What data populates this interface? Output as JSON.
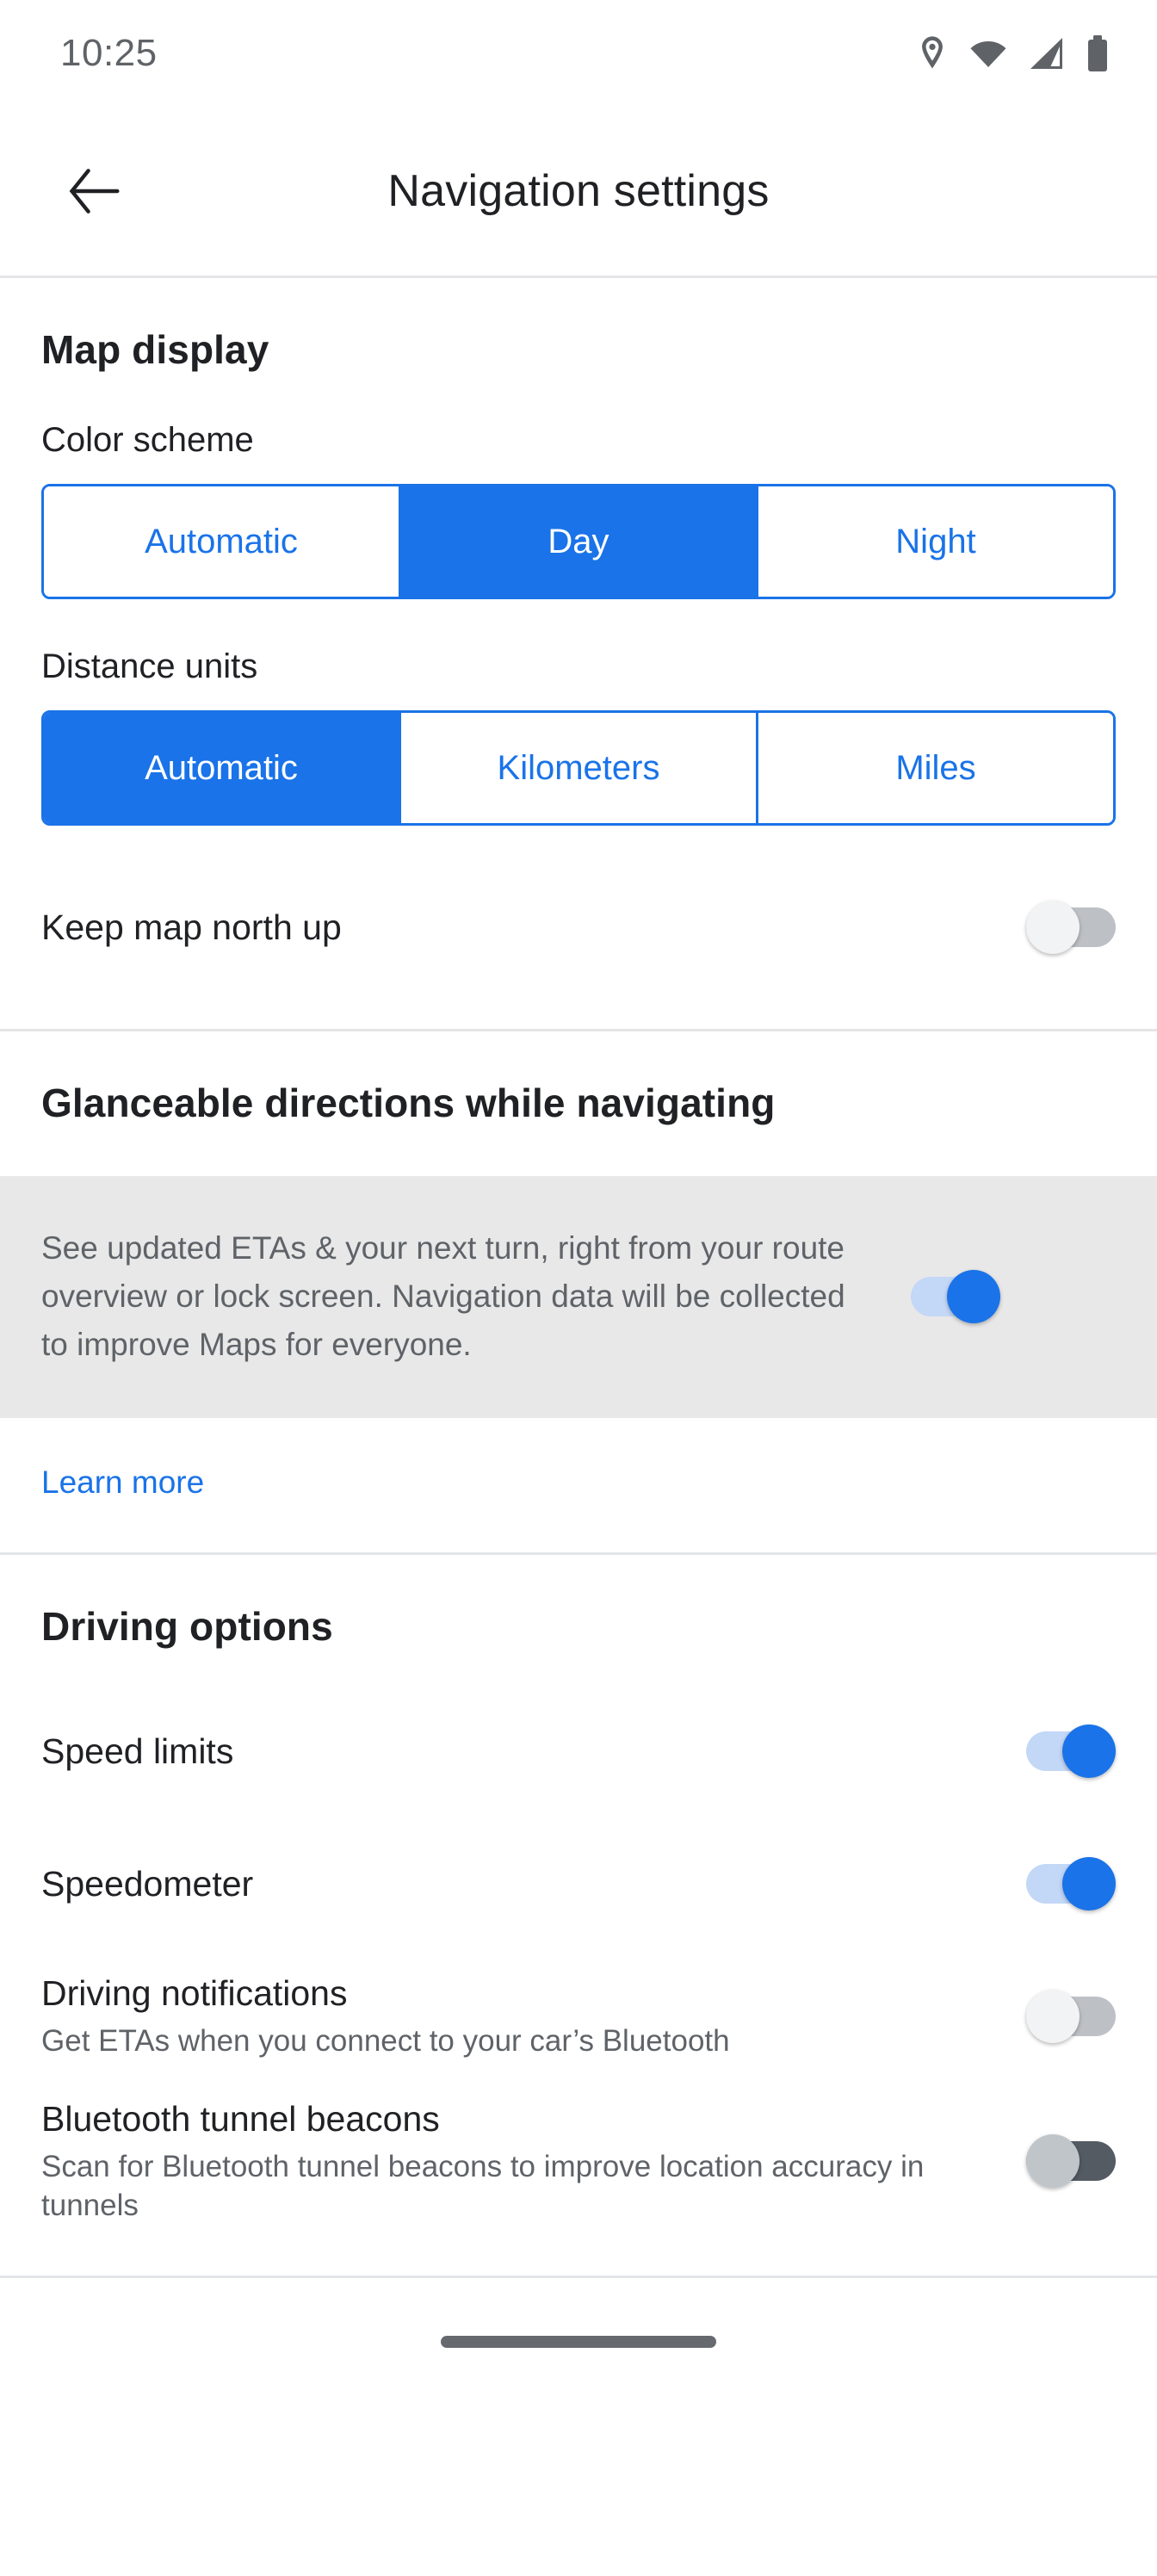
{
  "statusbar": {
    "time": "10:25",
    "icons": [
      "location-pin-icon",
      "wifi-icon",
      "cellular-signal-icon",
      "battery-icon"
    ]
  },
  "appbar": {
    "title": "Navigation settings",
    "back_icon": "back-arrow-icon"
  },
  "colors": {
    "accent": "#1a73e8",
    "accent_track": "#c3d7f7",
    "off_track": "#bdc1c6",
    "off_track_dark": "#545b63",
    "off_thumb_dark": "#c0c5ca",
    "text_primary": "#202124",
    "text_secondary": "#5f6368",
    "highlight_bg": "#e8e8e8",
    "divider": "#e4e5e7"
  },
  "sections": [
    {
      "title": "Map display",
      "fields": [
        {
          "label": "Color scheme",
          "options": [
            "Automatic",
            "Day",
            "Night"
          ],
          "selected": "Day"
        },
        {
          "label": "Distance units",
          "options": [
            "Automatic",
            "Kilometers",
            "Miles"
          ],
          "selected": "Automatic"
        }
      ],
      "rows": [
        {
          "title": "Keep map north up",
          "subtitle": "",
          "toggle": "off"
        }
      ]
    },
    {
      "title": "Glanceable directions while navigating",
      "highlight": {
        "text": "See updated ETAs & your next turn, right from your route overview or lock screen. Navigation data will be collected to improve Maps for everyone.",
        "toggle": "on"
      },
      "link": "Learn more"
    },
    {
      "title": "Driving options",
      "rows": [
        {
          "title": "Speed limits",
          "subtitle": "",
          "toggle": "on"
        },
        {
          "title": "Speedometer",
          "subtitle": "",
          "toggle": "on"
        },
        {
          "title": "Driving notifications",
          "subtitle": "Get ETAs when you connect to your car’s Bluetooth",
          "toggle": "off"
        },
        {
          "title": "Bluetooth tunnel beacons",
          "subtitle": "Scan for Bluetooth tunnel beacons to improve location accuracy in tunnels",
          "toggle": "off-dark"
        }
      ]
    }
  ]
}
